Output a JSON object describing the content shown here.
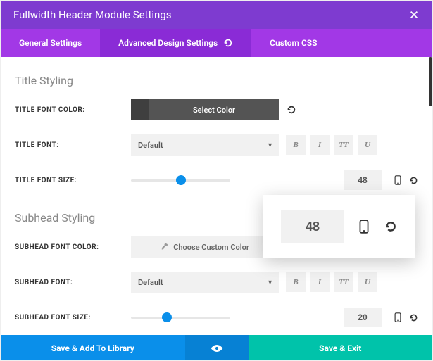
{
  "header": {
    "title": "Fullwidth Header Module Settings"
  },
  "tabs": {
    "general": "General Settings",
    "advanced": "Advanced Design Settings",
    "custom_css": "Custom CSS"
  },
  "sections": {
    "title_styling": "Title Styling",
    "subhead_styling": "Subhead Styling"
  },
  "labels": {
    "title_font_color": "TITLE FONT COLOR:",
    "title_font": "TITLE FONT:",
    "title_font_size": "TITLE FONT SIZE:",
    "subhead_font_color": "SUBHEAD FONT COLOR:",
    "subhead_font": "SUBHEAD FONT:",
    "subhead_font_size": "SUBHEAD FONT SIZE:"
  },
  "controls": {
    "select_color": "Select Color",
    "choose_custom_color": "Choose Custom Color",
    "default_font": "Default",
    "bold": "B",
    "italic": "I",
    "allcaps": "TT",
    "underline": "U"
  },
  "values": {
    "title_font_size": "48",
    "subhead_font_size": "20",
    "popover_value": "48",
    "title_slider_pct": 50,
    "subhead_slider_pct": 36
  },
  "footer": {
    "save_lib": "Save & Add To Library",
    "save_exit": "Save & Exit"
  }
}
